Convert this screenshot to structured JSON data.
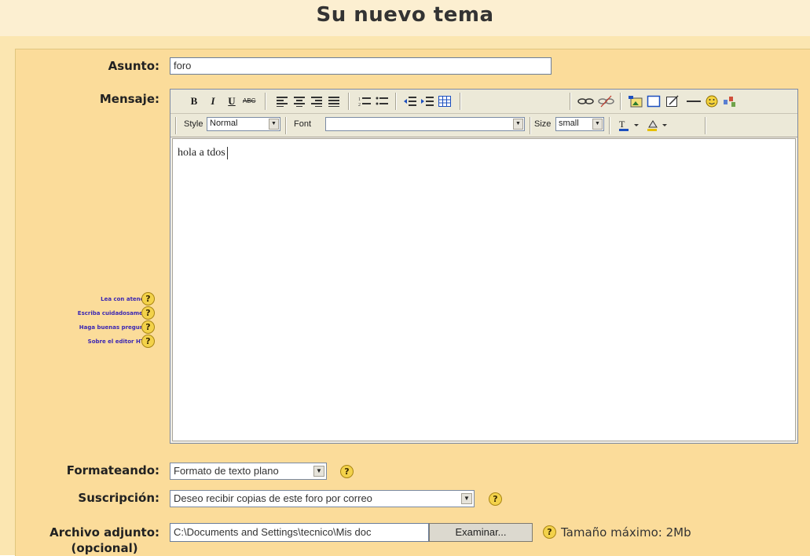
{
  "page_title": "Su nuevo tema",
  "labels": {
    "asunto": "Asunto:",
    "mensaje": "Mensaje:",
    "formateando": "Formateando:",
    "suscripcion": "Suscripción:",
    "archivo_line1": "Archivo adjunto:",
    "archivo_line2": "(opcional)"
  },
  "asunto_value": "foro",
  "help_links": [
    "Lea con atención",
    "Escriba cuidadosamente",
    "Haga buenas preguntas",
    "Sobre el editor HTML"
  ],
  "editor": {
    "toolbar1": {
      "bold": "B",
      "italic": "I",
      "underline": "U",
      "strike": "ABC"
    },
    "toolbar2": {
      "style_label": "Style",
      "style_value": "Normal",
      "font_label": "Font",
      "font_value": "",
      "size_label": "Size",
      "size_value": "small"
    },
    "content": "hola a tdos"
  },
  "formateando_value": "Formato de texto plano",
  "suscripcion_value": "Deseo recibir copias de este foro por correo",
  "archivo": {
    "path_value": "C:\\Documents and Settings\\tecnico\\Mis doc",
    "browse_label": "Examinar...",
    "max_size": "Tamaño máximo: 2Mb"
  },
  "help_icon_glyph": "?",
  "icons": {
    "help": "help-icon",
    "select_arrow": "dropdown-arrow-icon"
  }
}
